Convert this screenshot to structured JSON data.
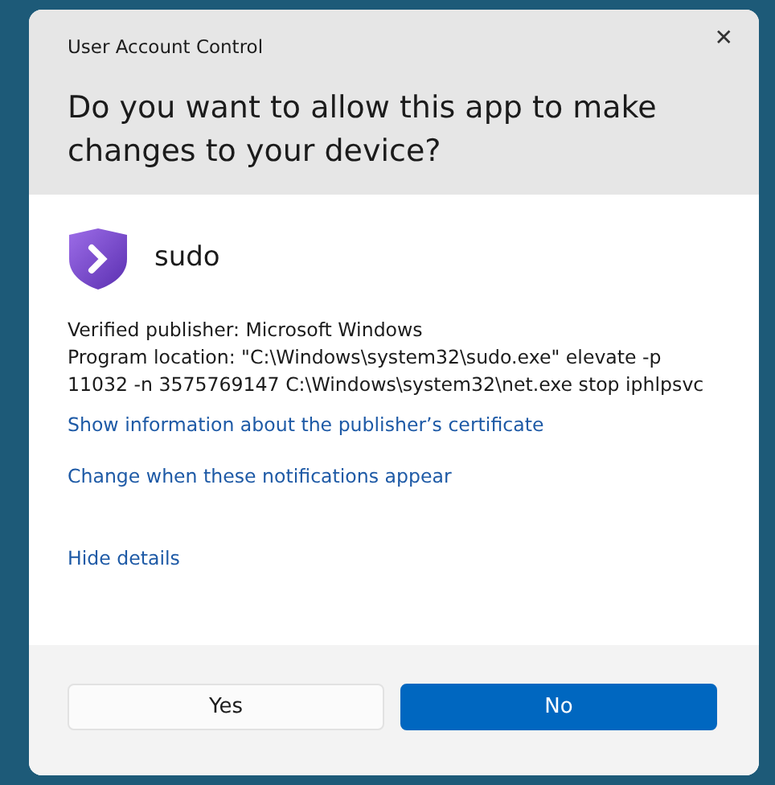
{
  "window": {
    "title": "User Account Control",
    "close": "✕"
  },
  "question": "Do you want to allow this app to make changes to your device?",
  "app": {
    "name": "sudo"
  },
  "details": [
    "Verified publisher: Microsoft Windows",
    "Program location: \"C:\\Windows\\system32\\sudo.exe\" elevate -p 11032 -n 3575769147 C:\\Windows\\system32\\net.exe stop iphlpsvc"
  ],
  "links": [
    "Show information about the publisher’s certificate",
    "Change when these notifications appear"
  ],
  "toggle_details": "Hide details",
  "buttons": [
    {
      "label": "Yes",
      "primary": false
    },
    {
      "label": "No",
      "primary": true
    }
  ]
}
